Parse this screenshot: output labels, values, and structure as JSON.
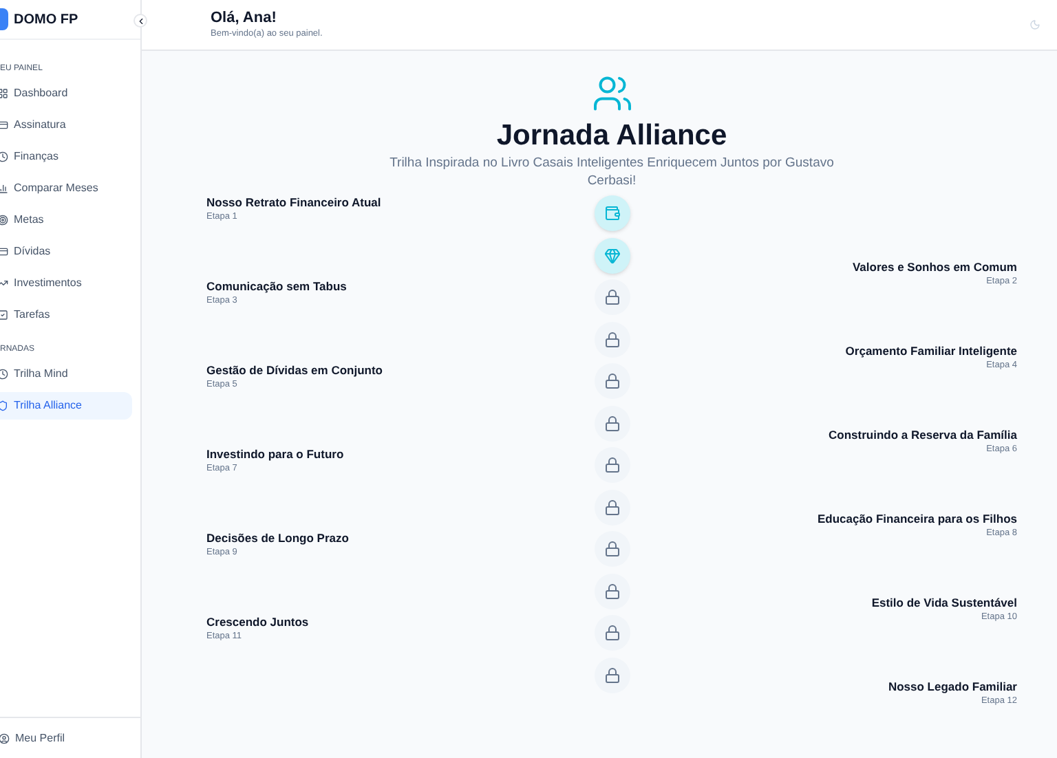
{
  "sidebar": {
    "brand": "DOMO FP",
    "sections": [
      {
        "title": "EU PAINEL",
        "items": [
          {
            "label": "Dashboard",
            "selected": false
          },
          {
            "label": "Assinatura",
            "selected": false
          },
          {
            "label": "Finanças",
            "selected": false
          },
          {
            "label": "Comparar Meses",
            "selected": false
          },
          {
            "label": "Metas",
            "selected": false
          },
          {
            "label": "Dívidas",
            "selected": false
          },
          {
            "label": "Investimentos",
            "selected": false
          },
          {
            "label": "Tarefas",
            "selected": false
          }
        ]
      },
      {
        "title": "RNADAS",
        "items": [
          {
            "label": "Trilha Mind",
            "selected": false
          },
          {
            "label": "Trilha Alliance",
            "selected": true
          }
        ]
      }
    ],
    "footer": {
      "label": "Meu Perfil"
    }
  },
  "header": {
    "greeting": "Olá, Ana!",
    "subtitle": "Bem-vindo(a) ao seu painel."
  },
  "journey": {
    "title": "Jornada Alliance",
    "subtitle": "Trilha Inspirada no Livro Casais Inteligentes Enriquecem Juntos por Gustavo Cerbasi!",
    "steps": [
      {
        "title": "Nosso Retrato Financeiro Atual",
        "stage": "Etapa 1",
        "locked": false
      },
      {
        "title": "Valores e Sonhos em Comum",
        "stage": "Etapa 2",
        "locked": false
      },
      {
        "title": "Comunicação sem Tabus",
        "stage": "Etapa 3",
        "locked": true
      },
      {
        "title": "Orçamento Familiar Inteligente",
        "stage": "Etapa 4",
        "locked": true
      },
      {
        "title": "Gestão de Dívidas em Conjunto",
        "stage": "Etapa 5",
        "locked": true
      },
      {
        "title": "Construindo a Reserva da Família",
        "stage": "Etapa 6",
        "locked": true
      },
      {
        "title": "Investindo para o Futuro",
        "stage": "Etapa 7",
        "locked": true
      },
      {
        "title": "Educação Financeira para os Filhos",
        "stage": "Etapa 8",
        "locked": true
      },
      {
        "title": "Decisões de Longo Prazo",
        "stage": "Etapa 9",
        "locked": true
      },
      {
        "title": "Estilo de Vida Sustentável",
        "stage": "Etapa 10",
        "locked": true
      },
      {
        "title": "Crescendo Juntos",
        "stage": "Etapa 11",
        "locked": true
      },
      {
        "title": "Nosso Legado Familiar",
        "stage": "Etapa 12",
        "locked": true
      }
    ]
  }
}
